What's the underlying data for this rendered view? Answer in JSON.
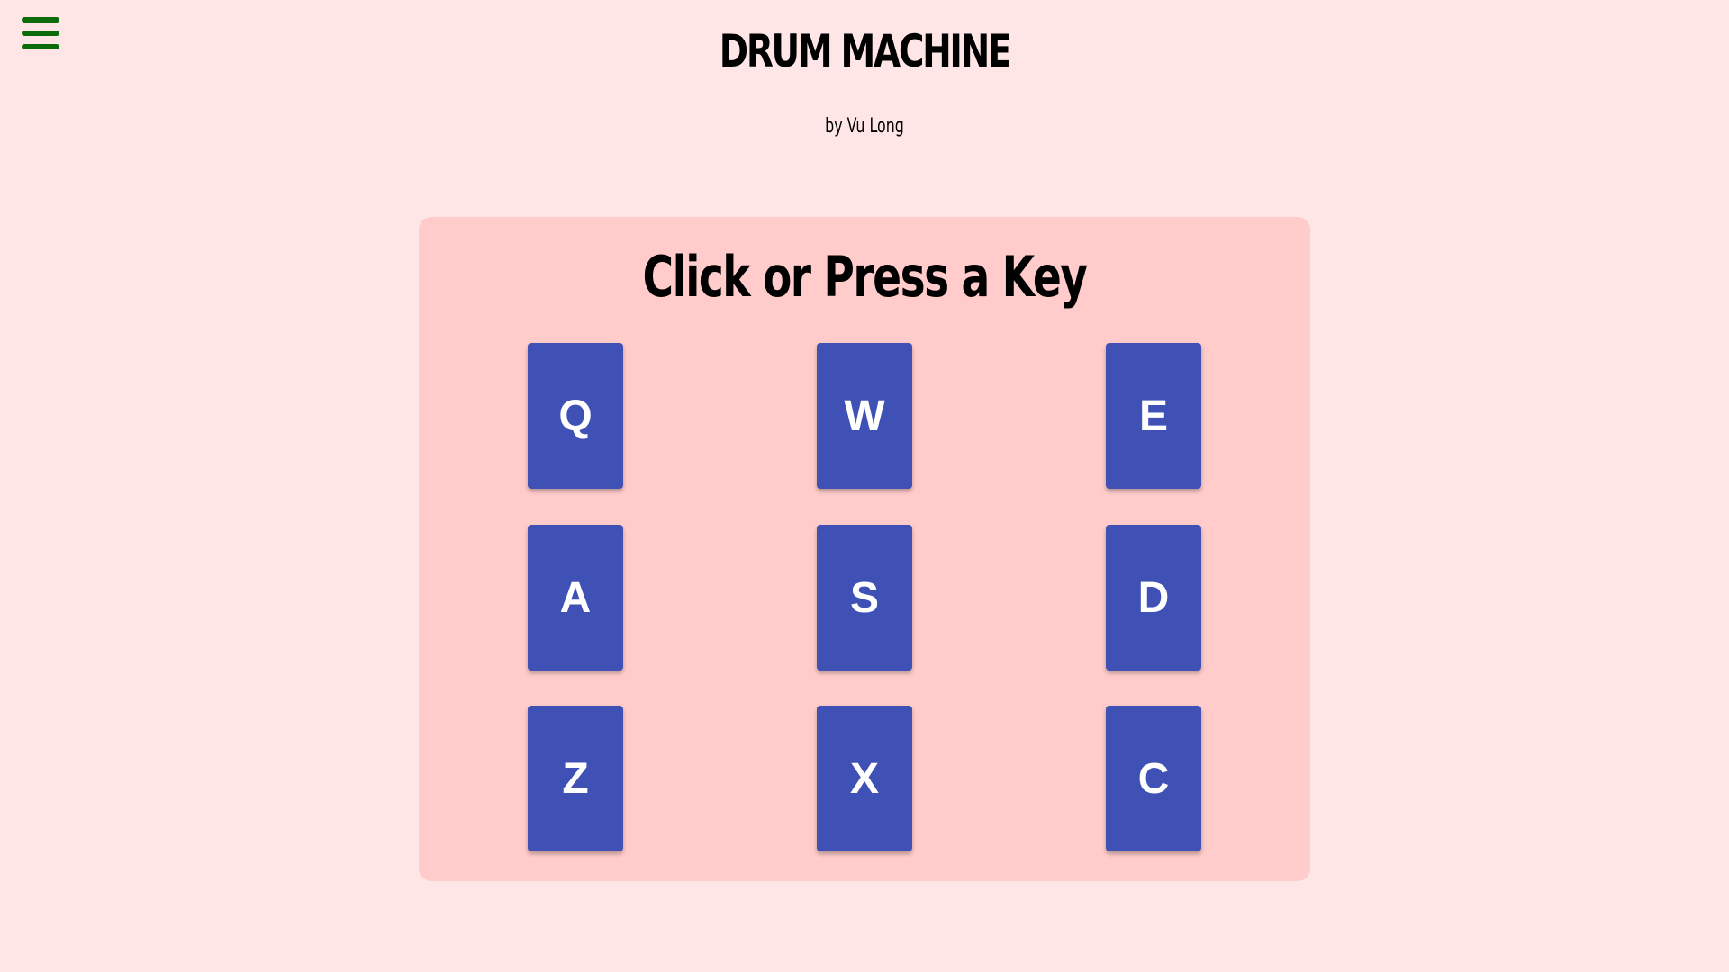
{
  "header": {
    "menu_icon": "hamburger-menu-icon",
    "title": "DRUM MACHINE",
    "subtitle": "by Vu Long"
  },
  "drum_machine": {
    "display_text": "Click or Press a Key",
    "pads": [
      {
        "key": "Q"
      },
      {
        "key": "W"
      },
      {
        "key": "E"
      },
      {
        "key": "A"
      },
      {
        "key": "S"
      },
      {
        "key": "D"
      },
      {
        "key": "Z"
      },
      {
        "key": "X"
      },
      {
        "key": "C"
      }
    ]
  },
  "colors": {
    "background": "#ffe6e6",
    "panel": "#ffcccb",
    "pad": "#3f51b5",
    "pad_text": "#ffffff",
    "menu_icon": "#0b6b0b"
  }
}
